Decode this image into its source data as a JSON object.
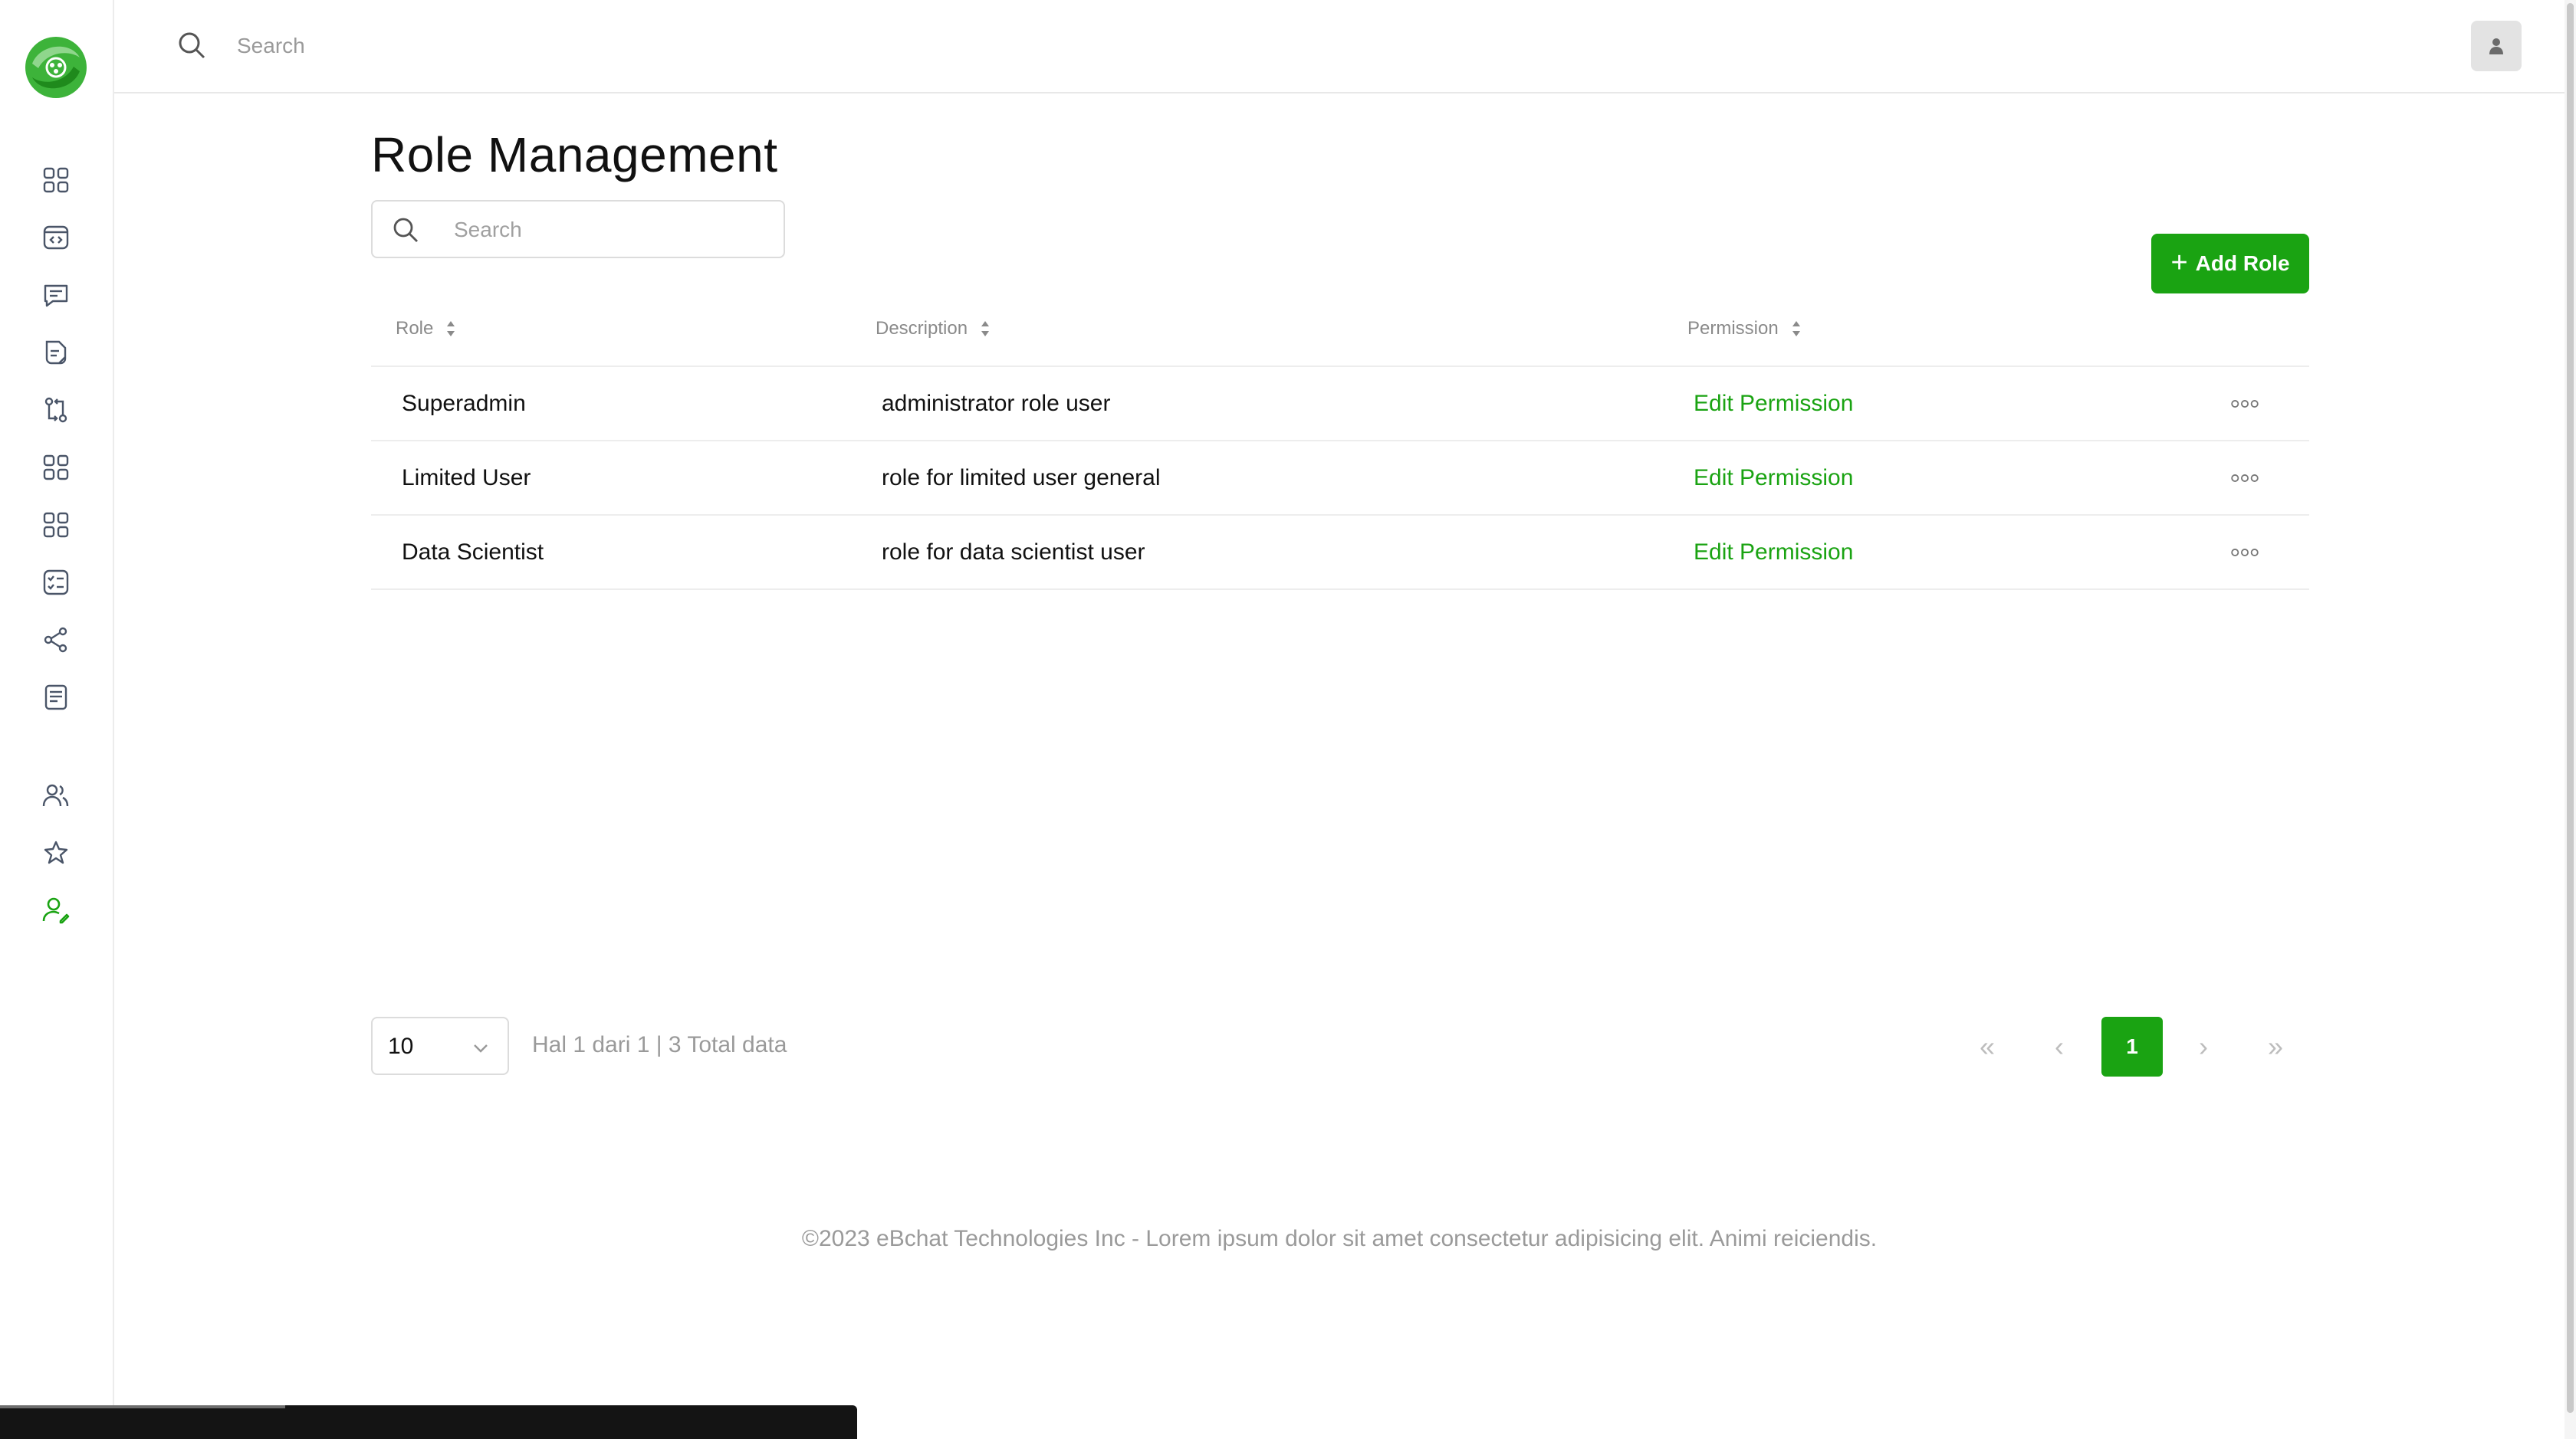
{
  "header": {
    "search_placeholder": "Search"
  },
  "page": {
    "title": "Role Management",
    "search_placeholder": "Search",
    "add_button_label": "Add Role"
  },
  "table": {
    "columns": [
      "Role",
      "Description",
      "Permission"
    ],
    "rows": [
      {
        "role": "Superadmin",
        "description": "administrator role user",
        "permission": "Edit Permission"
      },
      {
        "role": "Limited User",
        "description": "role for limited user general",
        "permission": "Edit Permission"
      },
      {
        "role": "Data Scientist",
        "description": "role for data scientist user",
        "permission": "Edit Permission"
      }
    ]
  },
  "pagination": {
    "page_size": "10",
    "info": "Hal 1 dari 1 | 3 Total data",
    "current_page": "1",
    "first": "«",
    "prev": "‹",
    "next": "›",
    "last": "»"
  },
  "footer": {
    "text": "©2023 eBchat Technologies Inc - Lorem ipsum dolor sit amet consectetur adipisicing elit. Animi reiciendis."
  },
  "sidebar": {
    "icons": [
      "dashboard-grid-icon",
      "code-window-icon",
      "chat-icon",
      "document-icon",
      "git-compare-icon",
      "apps-grid-icon",
      "modules-grid-icon",
      "checklist-icon",
      "share-icon",
      "notes-icon",
      "users-icon",
      "star-icon",
      "user-settings-icon"
    ],
    "active_icon": "user-settings-icon"
  },
  "colors": {
    "accent": "#1aa312",
    "icon": "#4a5568",
    "muted_text": "#9a9a9a"
  }
}
